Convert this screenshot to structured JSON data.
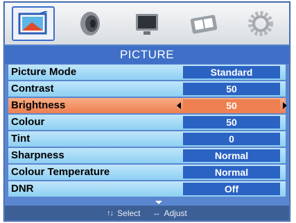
{
  "menu": {
    "title": "PICTURE",
    "active_tab": "picture",
    "tabs": [
      {
        "icon": "picture-icon"
      },
      {
        "icon": "sound-speaker-icon"
      },
      {
        "icon": "screen-monitor-icon"
      },
      {
        "icon": "clock-time-icon"
      },
      {
        "icon": "settings-gear-icon"
      }
    ]
  },
  "rows": [
    {
      "label": "Picture Mode",
      "value": "Standard"
    },
    {
      "label": "Contrast",
      "value": "50"
    },
    {
      "label": "Brightness",
      "value": "50",
      "selected": true
    },
    {
      "label": "Colour",
      "value": "50"
    },
    {
      "label": "Tint",
      "value": "0"
    },
    {
      "label": "Sharpness",
      "value": "Normal"
    },
    {
      "label": "Colour Temperature",
      "value": "Normal"
    },
    {
      "label": "DNR",
      "value": "Off"
    }
  ],
  "footer": {
    "select_keys": "↑↓",
    "select_label": "Select",
    "adjust_keys": "↔",
    "adjust_label": "Adjust"
  },
  "colors": {
    "frame": "#5a86cf",
    "row": "#a6dbf6",
    "value_box": "#2b63c3",
    "selected": "#ee7f50"
  }
}
